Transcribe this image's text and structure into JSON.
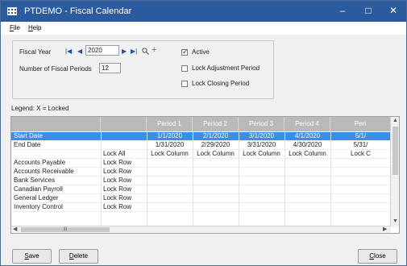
{
  "window": {
    "title": "PTDEMO - Fiscal Calendar",
    "minimize": "–",
    "maximize": "□",
    "close": "✕"
  },
  "menu": [
    {
      "label": "File",
      "mnemonic": "F",
      "rest": "ile"
    },
    {
      "label": "Help",
      "mnemonic": "H",
      "rest": "elp"
    }
  ],
  "form": {
    "fiscal_year_label": "Fiscal Year",
    "fiscal_year_value": "2020",
    "num_periods_label": "Number of Fiscal Periods",
    "num_periods_value": "12",
    "nav": {
      "first": "|◀",
      "prev": "◀",
      "next": "▶",
      "last": "▶|",
      "zoom": "🔍",
      "add": "+"
    },
    "checkboxes": [
      {
        "label": "Active",
        "checked": true
      },
      {
        "label": "Lock Adjustment Period",
        "checked": false
      },
      {
        "label": "Lock Closing Period",
        "checked": false
      }
    ]
  },
  "legend": "Legend: X = Locked",
  "grid": {
    "headers": [
      "",
      "",
      "Period 1",
      "Period 2",
      "Period 3",
      "Period 4",
      "Peri"
    ],
    "rows": [
      {
        "cells": [
          "Start Date",
          "",
          "1/1/2020",
          "2/1/2020",
          "3/1/2020",
          "4/1/2020",
          "5/1/"
        ],
        "selected": true
      },
      {
        "cells": [
          "End Date",
          "",
          "1/31/2020",
          "2/29/2020",
          "3/31/2020",
          "4/30/2020",
          "5/31/"
        ],
        "selected": false
      },
      {
        "cells": [
          "",
          "Lock All",
          "Lock Column",
          "Lock Column",
          "Lock Column",
          "Lock Column",
          "Lock C"
        ],
        "selected": false
      },
      {
        "cells": [
          "Accounts Payable",
          "Lock Row",
          "",
          "",
          "",
          "",
          ""
        ],
        "selected": false
      },
      {
        "cells": [
          "Accounts Receivable",
          "Lock Row",
          "",
          "",
          "",
          "",
          ""
        ],
        "selected": false
      },
      {
        "cells": [
          "Bank Services",
          "Lock Row",
          "",
          "",
          "",
          "",
          ""
        ],
        "selected": false
      },
      {
        "cells": [
          "Canadian Payroll",
          "Lock Row",
          "",
          "",
          "",
          "",
          ""
        ],
        "selected": false
      },
      {
        "cells": [
          "General Ledger",
          "Lock Row",
          "",
          "",
          "",
          "",
          ""
        ],
        "selected": false
      },
      {
        "cells": [
          "Inventory Control",
          "Lock Row",
          "",
          "",
          "",
          "",
          ""
        ],
        "selected": false
      }
    ],
    "hscroll_thumb": "III"
  },
  "buttons": {
    "save": {
      "mnemonic": "S",
      "rest": "ave"
    },
    "delete": {
      "mnemonic": "D",
      "rest": "elete"
    },
    "close": {
      "mnemonic": "C",
      "rest": "lose"
    }
  }
}
